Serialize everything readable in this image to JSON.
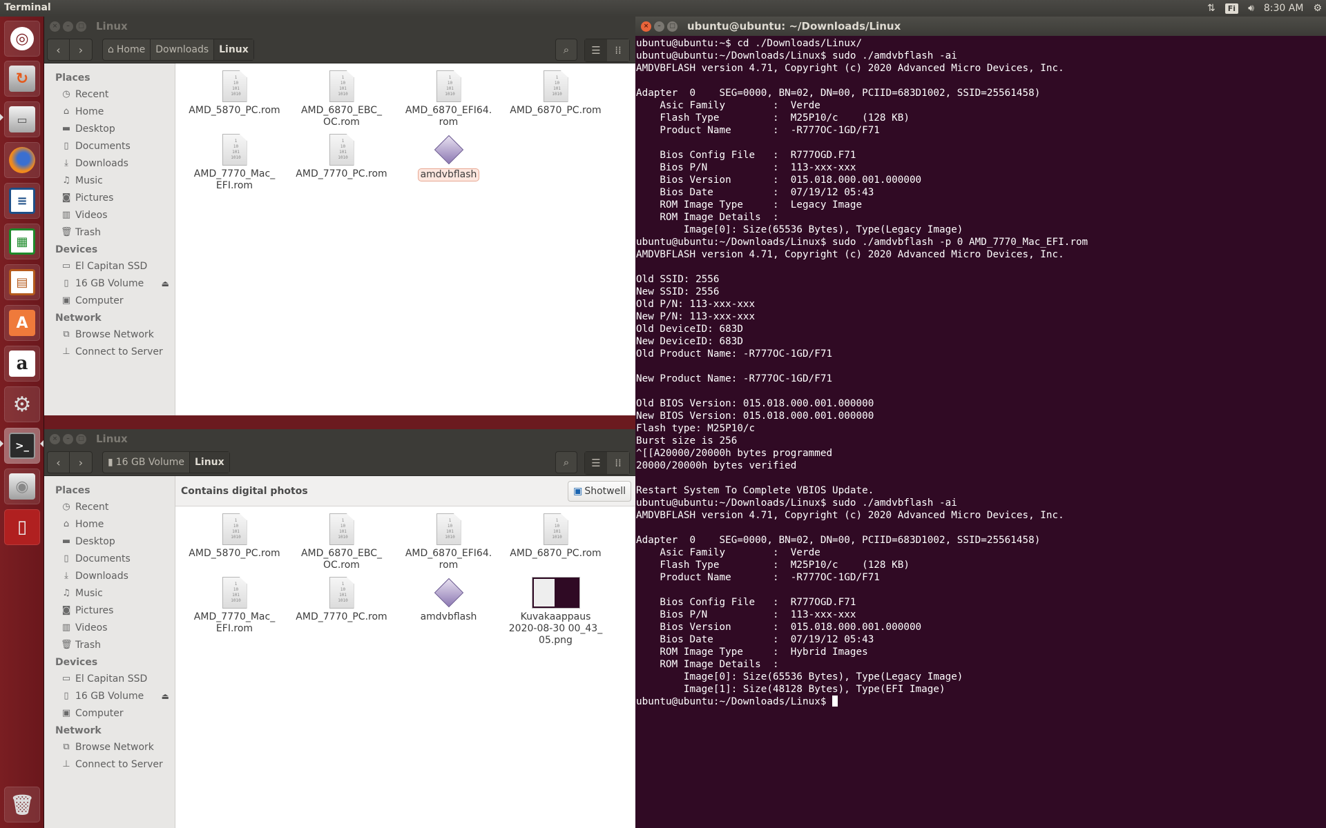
{
  "top_panel": {
    "app_title": "Terminal",
    "keyboard_layout": "Fi",
    "clock": "8:30 AM"
  },
  "launcher": {
    "items": [
      {
        "name": "dash-home",
        "label": "Dash"
      },
      {
        "name": "backups",
        "label": "Backups"
      },
      {
        "name": "files",
        "label": "Files"
      },
      {
        "name": "firefox",
        "label": "Firefox"
      },
      {
        "name": "libreoffice-writer",
        "label": "LibreOffice Writer"
      },
      {
        "name": "libreoffice-calc",
        "label": "LibreOffice Calc"
      },
      {
        "name": "libreoffice-impress",
        "label": "LibreOffice Impress"
      },
      {
        "name": "ubuntu-software",
        "label": "Ubuntu Software"
      },
      {
        "name": "amazon",
        "label": "Amazon"
      },
      {
        "name": "system-settings",
        "label": "System Settings"
      },
      {
        "name": "terminal",
        "label": "Terminal"
      },
      {
        "name": "el-capitan-ssd",
        "label": "El Capitan SSD"
      },
      {
        "name": "usb-volume",
        "label": "16 GB Volume"
      },
      {
        "name": "trash",
        "label": "Trash"
      }
    ]
  },
  "sidebar": {
    "places_heading": "Places",
    "places": [
      {
        "label": "Recent",
        "icon": "clock-icon"
      },
      {
        "label": "Home",
        "icon": "home-icon"
      },
      {
        "label": "Desktop",
        "icon": "folder-icon"
      },
      {
        "label": "Documents",
        "icon": "document-icon"
      },
      {
        "label": "Downloads",
        "icon": "download-icon"
      },
      {
        "label": "Music",
        "icon": "music-icon"
      },
      {
        "label": "Pictures",
        "icon": "camera-icon"
      },
      {
        "label": "Videos",
        "icon": "film-icon"
      },
      {
        "label": "Trash",
        "icon": "trash-icon"
      }
    ],
    "devices_heading": "Devices",
    "devices": [
      {
        "label": "El Capitan SSD",
        "icon": "drive-icon"
      },
      {
        "label": "16 GB Volume",
        "icon": "usb-icon",
        "eject": true
      },
      {
        "label": "Computer",
        "icon": "computer-icon"
      }
    ],
    "network_heading": "Network",
    "network": [
      {
        "label": "Browse Network",
        "icon": "network-icon"
      },
      {
        "label": "Connect to Server",
        "icon": "server-icon"
      }
    ]
  },
  "window_top": {
    "title": "Linux",
    "breadcrumb": [
      "Home",
      "Downloads",
      "Linux"
    ],
    "files": [
      {
        "name": "AMD_5870_PC.rom",
        "type": "rom"
      },
      {
        "name": "AMD_6870_EBC_\nOC.rom",
        "type": "rom"
      },
      {
        "name": "AMD_6870_EFI64.\nrom",
        "type": "rom"
      },
      {
        "name": "AMD_6870_PC.rom",
        "type": "rom"
      },
      {
        "name": "AMD_7770_Mac_\nEFI.rom",
        "type": "rom"
      },
      {
        "name": "AMD_7770_PC.rom",
        "type": "rom"
      },
      {
        "name": "amdvbflash",
        "type": "exec",
        "selected": true
      }
    ]
  },
  "window_bottom": {
    "title": "Linux",
    "breadcrumb": [
      "16 GB Volume",
      "Linux"
    ],
    "infobar_text": "Contains digital photos",
    "infobar_button": "Shotwell",
    "files": [
      {
        "name": "AMD_5870_PC.rom",
        "type": "rom"
      },
      {
        "name": "AMD_6870_EBC_\nOC.rom",
        "type": "rom"
      },
      {
        "name": "AMD_6870_EFI64.\nrom",
        "type": "rom"
      },
      {
        "name": "AMD_6870_PC.rom",
        "type": "rom"
      },
      {
        "name": "AMD_7770_Mac_\nEFI.rom",
        "type": "rom"
      },
      {
        "name": "AMD_7770_PC.rom",
        "type": "rom"
      },
      {
        "name": "amdvbflash",
        "type": "exec"
      },
      {
        "name": "Kuvakaappaus\n2020-08-30 00_43_\n05.png",
        "type": "image"
      }
    ]
  },
  "terminal": {
    "title": "ubuntu@ubuntu: ~/Downloads/Linux",
    "prompt": "ubuntu@ubuntu:~/Downloads/Linux$ ",
    "lines": [
      "ubuntu@ubuntu:~$ cd ./Downloads/Linux/",
      "ubuntu@ubuntu:~/Downloads/Linux$ sudo ./amdvbflash -ai",
      "AMDVBFLASH version 4.71, Copyright (c) 2020 Advanced Micro Devices, Inc.",
      "",
      "Adapter  0    SEG=0000, BN=02, DN=00, PCIID=683D1002, SSID=25561458)",
      "    Asic Family        :  Verde",
      "    Flash Type         :  M25P10/c    (128 KB)",
      "    Product Name       :  -R777OC-1GD/F71",
      "",
      "    Bios Config File   :  R777OGD.F71",
      "    Bios P/N           :  113-xxx-xxx",
      "    Bios Version       :  015.018.000.001.000000",
      "    Bios Date          :  07/19/12 05:43",
      "    ROM Image Type     :  Legacy Image",
      "    ROM Image Details  :",
      "        Image[0]: Size(65536 Bytes), Type(Legacy Image)",
      "ubuntu@ubuntu:~/Downloads/Linux$ sudo ./amdvbflash -p 0 AMD_7770_Mac_EFI.rom",
      "AMDVBFLASH version 4.71, Copyright (c) 2020 Advanced Micro Devices, Inc.",
      "",
      "Old SSID: 2556",
      "New SSID: 2556",
      "Old P/N: 113-xxx-xxx",
      "New P/N: 113-xxx-xxx",
      "Old DeviceID: 683D",
      "New DeviceID: 683D",
      "Old Product Name: -R777OC-1GD/F71",
      "",
      "New Product Name: -R777OC-1GD/F71",
      "",
      "Old BIOS Version: 015.018.000.001.000000",
      "New BIOS Version: 015.018.000.001.000000",
      "Flash type: M25P10/c",
      "Burst size is 256",
      "^[[A20000/20000h bytes programmed",
      "20000/20000h bytes verified",
      "",
      "Restart System To Complete VBIOS Update.",
      "ubuntu@ubuntu:~/Downloads/Linux$ sudo ./amdvbflash -ai",
      "AMDVBFLASH version 4.71, Copyright (c) 2020 Advanced Micro Devices, Inc.",
      "",
      "Adapter  0    SEG=0000, BN=02, DN=00, PCIID=683D1002, SSID=25561458)",
      "    Asic Family        :  Verde",
      "    Flash Type         :  M25P10/c    (128 KB)",
      "    Product Name       :  -R777OC-1GD/F71",
      "",
      "    Bios Config File   :  R777OGD.F71",
      "    Bios P/N           :  113-xxx-xxx",
      "    Bios Version       :  015.018.000.001.000000",
      "    Bios Date          :  07/19/12 05:43",
      "    ROM Image Type     :  Hybrid Images",
      "    ROM Image Details  :",
      "        Image[0]: Size(65536 Bytes), Type(Legacy Image)",
      "        Image[1]: Size(48128 Bytes), Type(EFI Image)"
    ]
  },
  "colors": {
    "terminal_bg": "#300a24",
    "launcher_bg": "#7a1e22",
    "titlebar_bg": "#3c3b37",
    "selection_accent": "#e8a893"
  }
}
